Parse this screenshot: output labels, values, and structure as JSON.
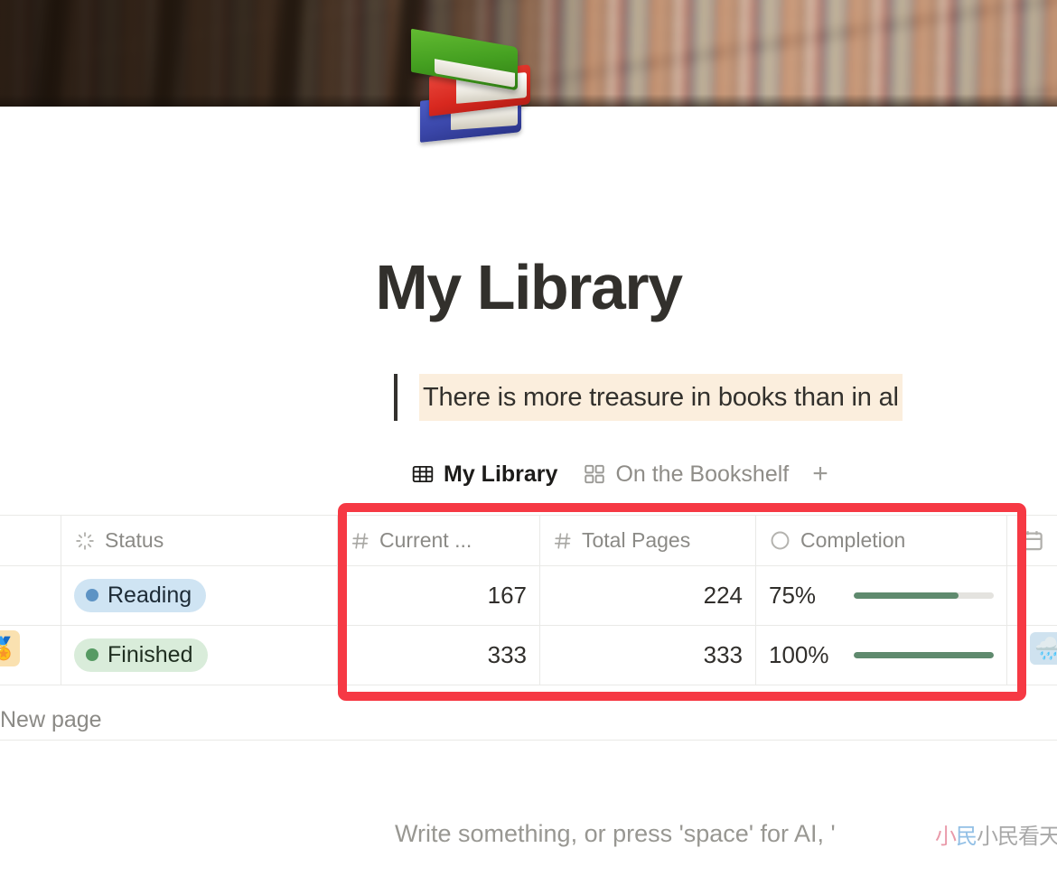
{
  "cover": {
    "alt": "blurred library bookshelf photo"
  },
  "page_icon": {
    "name": "books-emoji",
    "glyph": "📚"
  },
  "header": {
    "title": "My Library",
    "quote": "There is more treasure in books than in al"
  },
  "tabs": {
    "items": [
      {
        "label": "My Library",
        "icon": "table-icon",
        "active": true
      },
      {
        "label": "On the Bookshelf",
        "icon": "gallery-icon",
        "active": false
      }
    ],
    "add_label": "+"
  },
  "table": {
    "columns": [
      {
        "key": "pad",
        "label": "",
        "icon": ""
      },
      {
        "key": "status",
        "label": "Status",
        "icon": "status-icon"
      },
      {
        "key": "current",
        "label": "Current ...",
        "icon": "number-icon"
      },
      {
        "key": "total",
        "label": "Total Pages",
        "icon": "number-icon"
      },
      {
        "key": "completion",
        "label": "Completion",
        "icon": "progress-circle-icon"
      },
      {
        "key": "date",
        "label": "",
        "icon": "calendar-icon"
      }
    ],
    "rows": [
      {
        "status": "Reading",
        "status_style": "reading",
        "current": "167",
        "total": "224",
        "completion_pct": "75%",
        "completion_value": 75,
        "edge_tag": "",
        "edge_emoji": ""
      },
      {
        "status": "Finished",
        "status_style": "finished",
        "current": "333",
        "total": "333",
        "completion_pct": "100%",
        "completion_value": 100,
        "edge_tag": "🏅",
        "edge_emoji": "🌧️"
      }
    ],
    "new_row_label": "New page"
  },
  "body": {
    "placeholder": "Write something, or press 'space' for AI, '"
  },
  "watermark": {
    "text": "小民看天下.com"
  },
  "colors": {
    "annotation_red": "#f63944",
    "progress_green": "#5f8a6e",
    "progress_track": "#e4e3df",
    "quote_highlight": "#fbeedd",
    "pill_reading_bg": "#cfe4f3",
    "pill_finished_bg": "#d9ecda",
    "title_text": "#32302c",
    "muted_text": "#8b8a86"
  }
}
